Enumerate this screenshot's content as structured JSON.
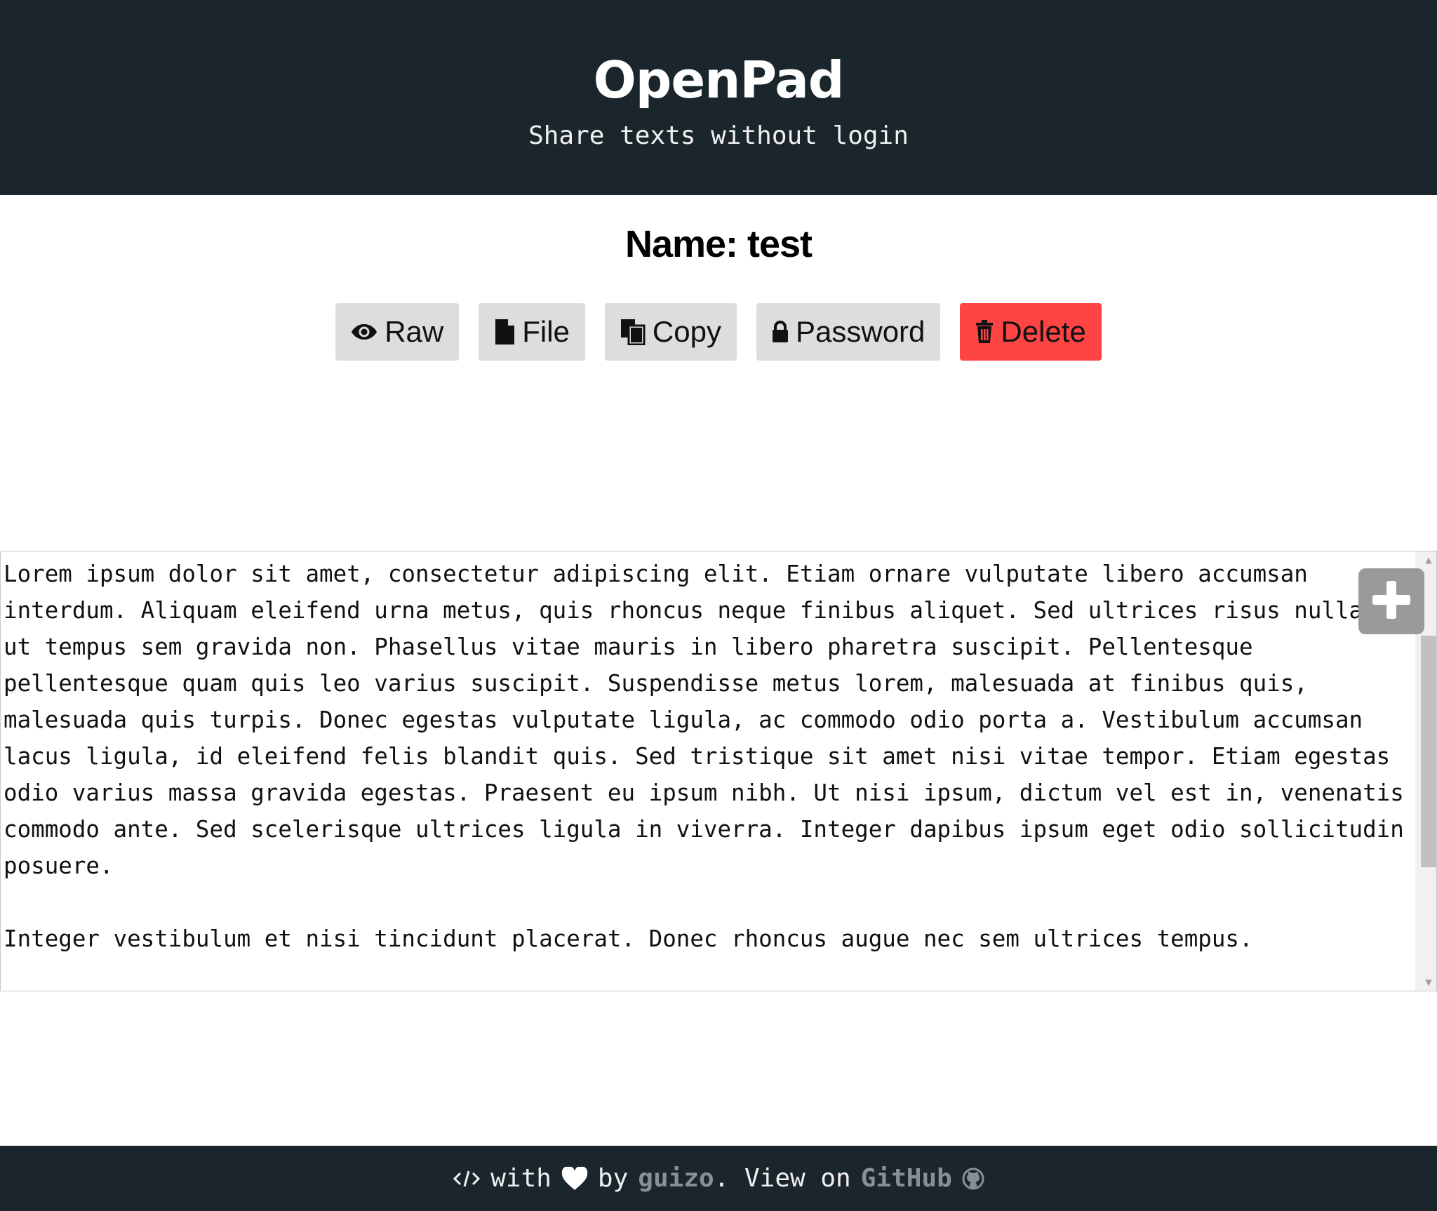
{
  "header": {
    "title": "OpenPad",
    "subtitle": "Share texts without login"
  },
  "pad": {
    "name_label": "Name: test"
  },
  "toolbar": {
    "raw_label": "Raw",
    "file_label": "File",
    "copy_label": "Copy",
    "password_label": "Password",
    "delete_label": "Delete"
  },
  "editor": {
    "content": "Lorem ipsum dolor sit amet, consectetur adipiscing elit. Etiam ornare vulputate libero accumsan interdum. Aliquam eleifend urna metus, quis rhoncus neque finibus aliquet. Sed ultrices risus nulla, ut tempus sem gravida non. Phasellus vitae mauris in libero pharetra suscipit. Pellentesque pellentesque quam quis leo varius suscipit. Suspendisse metus lorem, malesuada at finibus quis, malesuada quis turpis. Donec egestas vulputate ligula, ac commodo odio porta a. Vestibulum accumsan lacus ligula, id eleifend felis blandit quis. Sed tristique sit amet nisi vitae tempor. Etiam egestas odio varius massa gravida egestas. Praesent eu ipsum nibh. Ut nisi ipsum, dictum vel est in, venenatis commodo ante. Sed scelerisque ultrices ligula in viverra. Integer dapibus ipsum eget odio sollicitudin posuere.\n\nInteger vestibulum et nisi tincidunt placerat. Donec rhoncus augue nec sem ultrices tempus."
  },
  "footer": {
    "with_text": "with",
    "by_text": "by",
    "author": "guizo",
    "view_on_text": ". View on",
    "github_label": "GitHub"
  },
  "colors": {
    "header_bg": "#1b262c",
    "button_bg": "#dddddd",
    "delete_bg": "#ff4444",
    "link_muted": "#8a8f93"
  }
}
